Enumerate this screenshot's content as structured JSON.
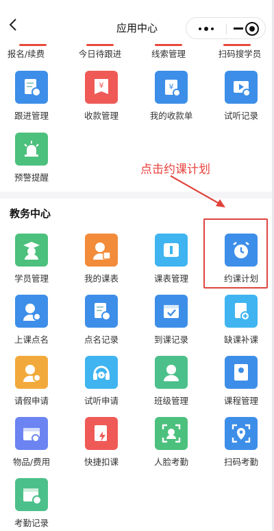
{
  "nav": {
    "title": "应用中心",
    "back_icon": "chevron-left-icon"
  },
  "top_row": [
    {
      "label": "报名/续费",
      "color": "#e64a3c"
    },
    {
      "label": "今日待跟进",
      "color": "#e64a3c"
    },
    {
      "label": "线索管理",
      "color": "#e64a3c"
    },
    {
      "label": "扫码搜学员",
      "color": "#e64a3c"
    }
  ],
  "group1": [
    {
      "label": "跟进管理",
      "color": "#3d8ee8",
      "icon": "document-clock-icon"
    },
    {
      "label": "收款管理",
      "color": "#ef5a57",
      "icon": "yen-wallet-icon"
    },
    {
      "label": "我的收款单",
      "color": "#3d8ee8",
      "icon": "yen-clipboard-icon"
    },
    {
      "label": "试听记录",
      "color": "#3d8ee8",
      "icon": "tv-play-icon"
    },
    {
      "label": "预警提醒",
      "color": "#4cc07d",
      "icon": "alarm-light-icon"
    }
  ],
  "section": {
    "title": "教务中心"
  },
  "annotation": {
    "text": "点击约课计划",
    "color": "#e8413c"
  },
  "group2": [
    {
      "label": "学员管理",
      "color": "#4cc07d",
      "icon": "graduate-icon"
    },
    {
      "label": "我的课表",
      "color": "#f28b3a",
      "icon": "person-schedule-icon"
    },
    {
      "label": "课表管理",
      "color": "#3fb4f0",
      "icon": "book-icon"
    },
    {
      "label": "约课计划",
      "color": "#3d8ee8",
      "icon": "alarm-clock-icon"
    },
    {
      "label": "上课点名",
      "color": "#3d8ee8",
      "icon": "person-check-icon"
    },
    {
      "label": "点名记录",
      "color": "#3d8ee8",
      "icon": "document-clock-icon"
    },
    {
      "label": "到课记录",
      "color": "#3d8ee8",
      "icon": "calendar-check-icon"
    },
    {
      "label": "缺课补课",
      "color": "#3fb4f0",
      "icon": "book-plus-icon"
    },
    {
      "label": "请假申请",
      "color": "#f2a93b",
      "icon": "person-clock-icon"
    },
    {
      "label": "试听申请",
      "color": "#3fb4f0",
      "icon": "headphones-icon"
    },
    {
      "label": "班级管理",
      "color": "#4cc08a",
      "icon": "group-icon"
    },
    {
      "label": "课程管理",
      "color": "#3d8ee8",
      "icon": "gear-book-icon"
    },
    {
      "label": "物品/费用",
      "color": "#6b84f2",
      "icon": "box-yen-icon"
    },
    {
      "label": "快捷扣课",
      "color": "#ef5a57",
      "icon": "document-bolt-icon"
    },
    {
      "label": "人脸考勤",
      "color": "#4cc07d",
      "icon": "face-scan-icon"
    },
    {
      "label": "扫码考勤",
      "color": "#3d8ee8",
      "icon": "location-scan-icon"
    },
    {
      "label": "考勤记录",
      "color": "#4cc08a",
      "icon": "calendar-clock-icon"
    }
  ]
}
